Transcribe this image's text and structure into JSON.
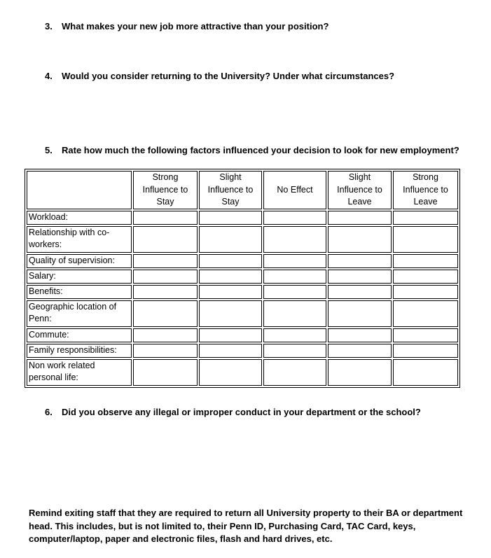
{
  "questions": [
    {
      "number": "3.",
      "text": "What makes your new job more attractive than your position?"
    },
    {
      "number": "4.",
      "text": "Would you consider returning to the University? Under what circumstances?"
    },
    {
      "number": "5.",
      "text": "Rate how much the following factors influenced your decision to look for new employment?"
    },
    {
      "number": "6.",
      "text": "Did you observe any illegal or improper conduct in your department or the school?"
    }
  ],
  "rating_table": {
    "columns": [
      {
        "line1": "Strong",
        "line2": "Influence to",
        "line3": "Stay"
      },
      {
        "line1": "Slight",
        "line2": "Influence to",
        "line3": "Stay"
      },
      {
        "line1": "",
        "line2": "No Effect",
        "line3": ""
      },
      {
        "line1": "Slight",
        "line2": "Influence to",
        "line3": "Leave"
      },
      {
        "line1": "Strong",
        "line2": "Influence to",
        "line3": "Leave"
      }
    ],
    "rows": [
      {
        "label": "Workload:"
      },
      {
        "label": "Relationship with co-workers:"
      },
      {
        "label": "Quality of supervision:"
      },
      {
        "label": "Salary:"
      },
      {
        "label": "Benefits:"
      },
      {
        "label": "Geographic location of Penn:"
      },
      {
        "label": "Commute:"
      },
      {
        "label": "Family responsibilities:"
      },
      {
        "label": "Non work related personal life:"
      }
    ]
  },
  "reminder": "Remind exiting staff that they are required to return all University property to their BA or department head. This includes, but is not limited to, their Penn ID, Purchasing Card, TAC Card, keys, computer/laptop, paper and electronic files, flash and hard drives, etc."
}
